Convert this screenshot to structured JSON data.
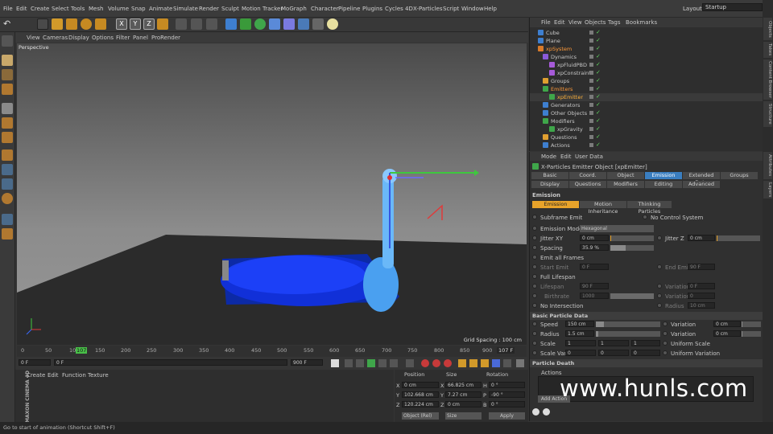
{
  "menu": [
    "File",
    "Edit",
    "Create",
    "Select",
    "Tools",
    "Mesh",
    "Volume",
    "Snap",
    "Animate",
    "Simulate",
    "Render",
    "Sculpt",
    "Motion Tracker",
    "MoGraph",
    "Character",
    "Pipeline",
    "Plugins",
    "Cycles 4D",
    "X-Particles",
    "Script",
    "Window",
    "Help"
  ],
  "layout": {
    "label": "Layout:",
    "value": "Startup"
  },
  "viewport": {
    "menu": [
      "View",
      "Cameras",
      "Display",
      "Options",
      "Filter",
      "Panel",
      "ProRender"
    ],
    "name": "Perspective",
    "grid_spacing": "Grid Spacing : 100 cm"
  },
  "timeline": {
    "ticks": [
      "0",
      "50",
      "100",
      "107",
      "150",
      "200",
      "250",
      "300",
      "350",
      "400",
      "450",
      "500",
      "550",
      "600",
      "650",
      "700",
      "750",
      "800",
      "850",
      "900"
    ],
    "end_label": "107 F",
    "start": "0 F",
    "cur": "0 F",
    "range_end": "900 F",
    "range_end2": "900 F"
  },
  "objects": {
    "menu": [
      "File",
      "Edit",
      "View",
      "Objects",
      "Tags",
      "Bookmarks"
    ],
    "rows": [
      {
        "name": "Cube",
        "color": "#c8c8c8"
      },
      {
        "name": "Plane",
        "color": "#c8c8c8"
      },
      {
        "name": "xpSystem",
        "color": "#ff9a3a"
      },
      {
        "name": "Dynamics",
        "color": "#c8c8c8"
      },
      {
        "name": "xpFluidPBD",
        "color": "#c8c8c8"
      },
      {
        "name": "xpConstraints",
        "color": "#c8c8c8"
      },
      {
        "name": "Groups",
        "color": "#c8c8c8"
      },
      {
        "name": "Emitters",
        "color": "#ff9a3a"
      },
      {
        "name": "xpEmitter",
        "color": "#ffb23a"
      },
      {
        "name": "Generators",
        "color": "#c8c8c8"
      },
      {
        "name": "Other Objects",
        "color": "#c8c8c8"
      },
      {
        "name": "Modifiers",
        "color": "#c8c8c8"
      },
      {
        "name": "xpGravity",
        "color": "#c8c8c8"
      },
      {
        "name": "Questions",
        "color": "#c8c8c8"
      },
      {
        "name": "Actions",
        "color": "#c8c8c8"
      }
    ]
  },
  "attr": {
    "menu": [
      "Mode",
      "Edit",
      "User Data"
    ],
    "title": "X-Particles Emitter Object [xpEmitter]",
    "tabs1": [
      "Basic",
      "Coord.",
      "Object",
      "Emission",
      "Extended Data",
      "Groups"
    ],
    "tabs2": [
      "Display",
      "Questions",
      "Modifiers",
      "Editing",
      "Advanced"
    ],
    "section": "Emission",
    "subtabs": [
      "Emission",
      "Motion Inheritance",
      "Thinking Particles"
    ],
    "subframe": "Subframe Emit",
    "no_control": "No Control System",
    "emission_mode_label": "Emission Mode",
    "emission_mode": "Hexagonal",
    "jitter_xy_label": "Jitter XY",
    "jitter_xy": "0 cm",
    "jitter_z_label": "Jitter Z",
    "jitter_z": "0 cm",
    "spacing_label": "Spacing",
    "spacing": "35.9 %",
    "emit_all": "Emit all Frames",
    "start_emit_label": "Start Emit",
    "start_emit": "0 F",
    "end_emit_label": "End Emit",
    "end_emit": "90 F",
    "full_life": "Full Lifespan",
    "lifespan_label": "Lifespan",
    "lifespan": "90 F",
    "variation_label": "Variation",
    "variation": "0 F",
    "birthrate_label": "Birthrate",
    "birthrate": "1000",
    "variation2": "0",
    "no_intersection": "No Intersection",
    "radius_label": "Radius",
    "radius_dim": "10 cm",
    "basic_data": "Basic Particle Data",
    "speed_label": "Speed",
    "speed": "150 cm",
    "speed_var": "0 cm",
    "radius2_label": "Radius",
    "radius2": "1.5 cm",
    "radius_var": "0 cm",
    "scale_label": "Scale",
    "scale": [
      "1",
      "1",
      "1"
    ],
    "uniform_scale": "Uniform Scale",
    "scale_var_label": "Scale Var.",
    "scale_var": [
      "0",
      "0",
      "0"
    ],
    "uniform_var": "Uniform Variation",
    "death": "Particle Death",
    "actions": "Actions",
    "add_action": "Add Action"
  },
  "coords": {
    "headers": [
      "Position",
      "Size",
      "Rotation"
    ],
    "rows": [
      {
        "axis": "X",
        "pos": "0 cm",
        "size": "66.825 cm",
        "rl": "H",
        "rot": "0 °"
      },
      {
        "axis": "Y",
        "pos": "102.668 cm",
        "size": "7.27 cm",
        "rl": "P",
        "rot": "-90 °"
      },
      {
        "axis": "Z",
        "pos": "120.224 cm",
        "size": "0 cm",
        "rl": "B",
        "rot": "0 °"
      }
    ],
    "mode": "Object (Rel)",
    "size_mode": "Size",
    "apply": "Apply"
  },
  "material": {
    "menu": [
      "Create",
      "Edit",
      "Function",
      "Texture"
    ]
  },
  "status": "Go to start of animation (Shortcut Shift+F)",
  "rtabs": [
    "Objects",
    "Takes",
    "Content Browser",
    "Structure"
  ],
  "rtabs2": [
    "Attributes",
    "Layers"
  ],
  "watermark": "www.hunls.com",
  "maxon": "MAXON CINEMA 4D"
}
